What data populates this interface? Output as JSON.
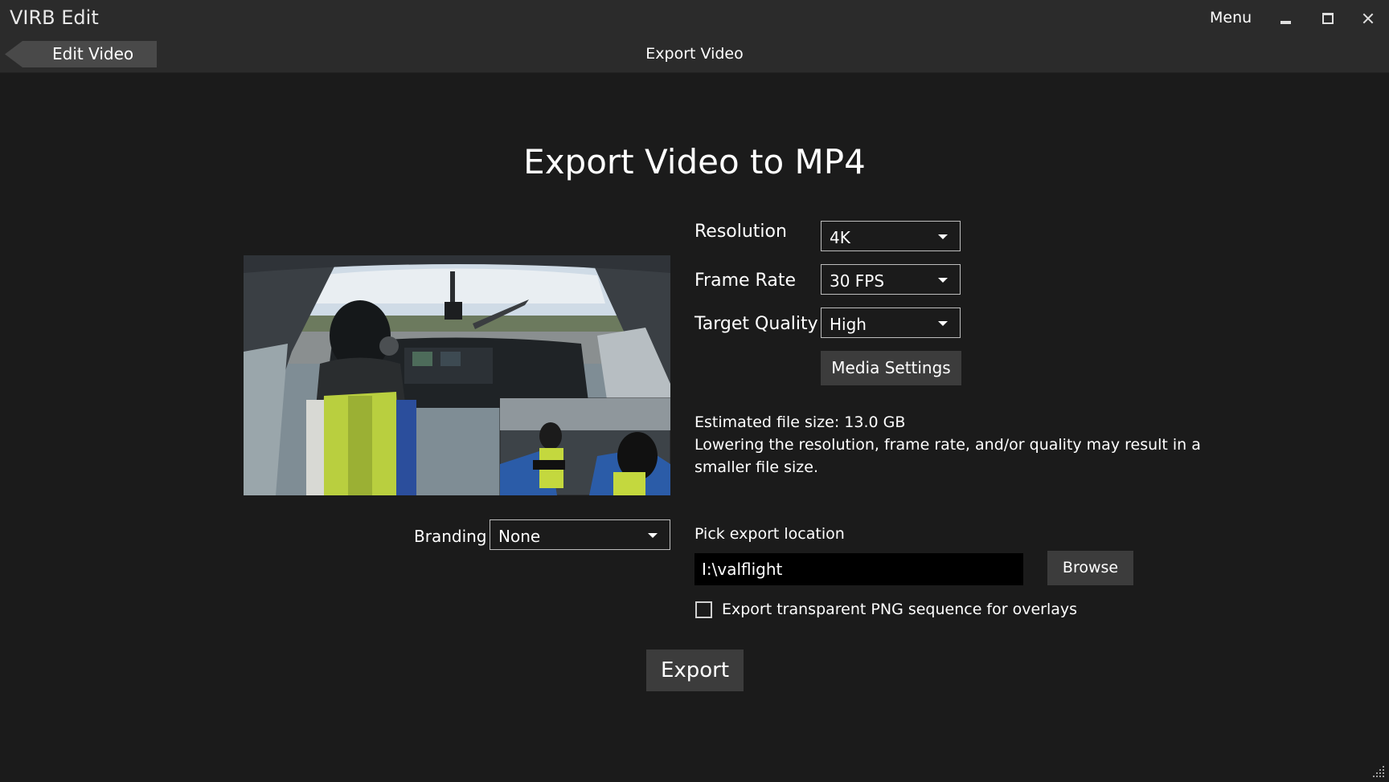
{
  "window": {
    "title": "VIRB Edit",
    "menu_label": "Menu"
  },
  "nav": {
    "back_label": "Edit Video",
    "page_title": "Export Video"
  },
  "main": {
    "heading": "Export Video to MP4"
  },
  "settings": {
    "resolution": {
      "label": "Resolution",
      "value": "4K"
    },
    "frame_rate": {
      "label": "Frame Rate",
      "value": "30 FPS"
    },
    "quality": {
      "label": "Target Quality",
      "value": "High"
    },
    "media_settings_label": "Media Settings"
  },
  "estimate": {
    "label": "Estimated file size:",
    "value": "13.0 GB",
    "note_line1": "Lowering the resolution, frame rate, and/or quality may result in a",
    "note_line2": "smaller file size."
  },
  "branding": {
    "label": "Branding",
    "value": "None"
  },
  "export_location": {
    "label": "Pick export location",
    "path": "I:\\valflight",
    "browse_label": "Browse"
  },
  "png_sequence": {
    "label": "Export transparent PNG sequence for overlays",
    "checked": false
  },
  "export_label": "Export",
  "colors": {
    "background": "#1b1b1b",
    "bar": "#2b2b2b",
    "button": "#3c3c3c",
    "input": "#000000"
  },
  "icons": [
    "minimize-icon",
    "maximize-icon",
    "close-icon",
    "back-arrow-icon",
    "dropdown-caret-icon",
    "resize-grip-icon"
  ]
}
